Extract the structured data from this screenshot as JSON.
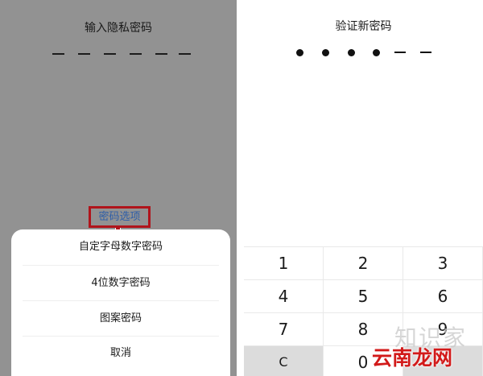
{
  "left_screen": {
    "title": "输入隐私密码",
    "options_button": "密码选项",
    "menu_items": [
      "自定字母数字密码",
      "4位数字密码",
      "图案密码",
      "取消"
    ]
  },
  "right_screen": {
    "title": "验证新密码",
    "entered_digits": 4,
    "total_digits": 6,
    "keys": [
      "1",
      "2",
      "3",
      "4",
      "5",
      "6",
      "7",
      "8",
      "9",
      "C",
      "0"
    ]
  },
  "watermark": {
    "line1": "知识家",
    "line2": "云南龙网"
  },
  "colors": {
    "overlay": "#929292",
    "highlight_border": "#b0141b",
    "link_text": "#2e5ea8",
    "watermark_red": "#d21a1a"
  }
}
